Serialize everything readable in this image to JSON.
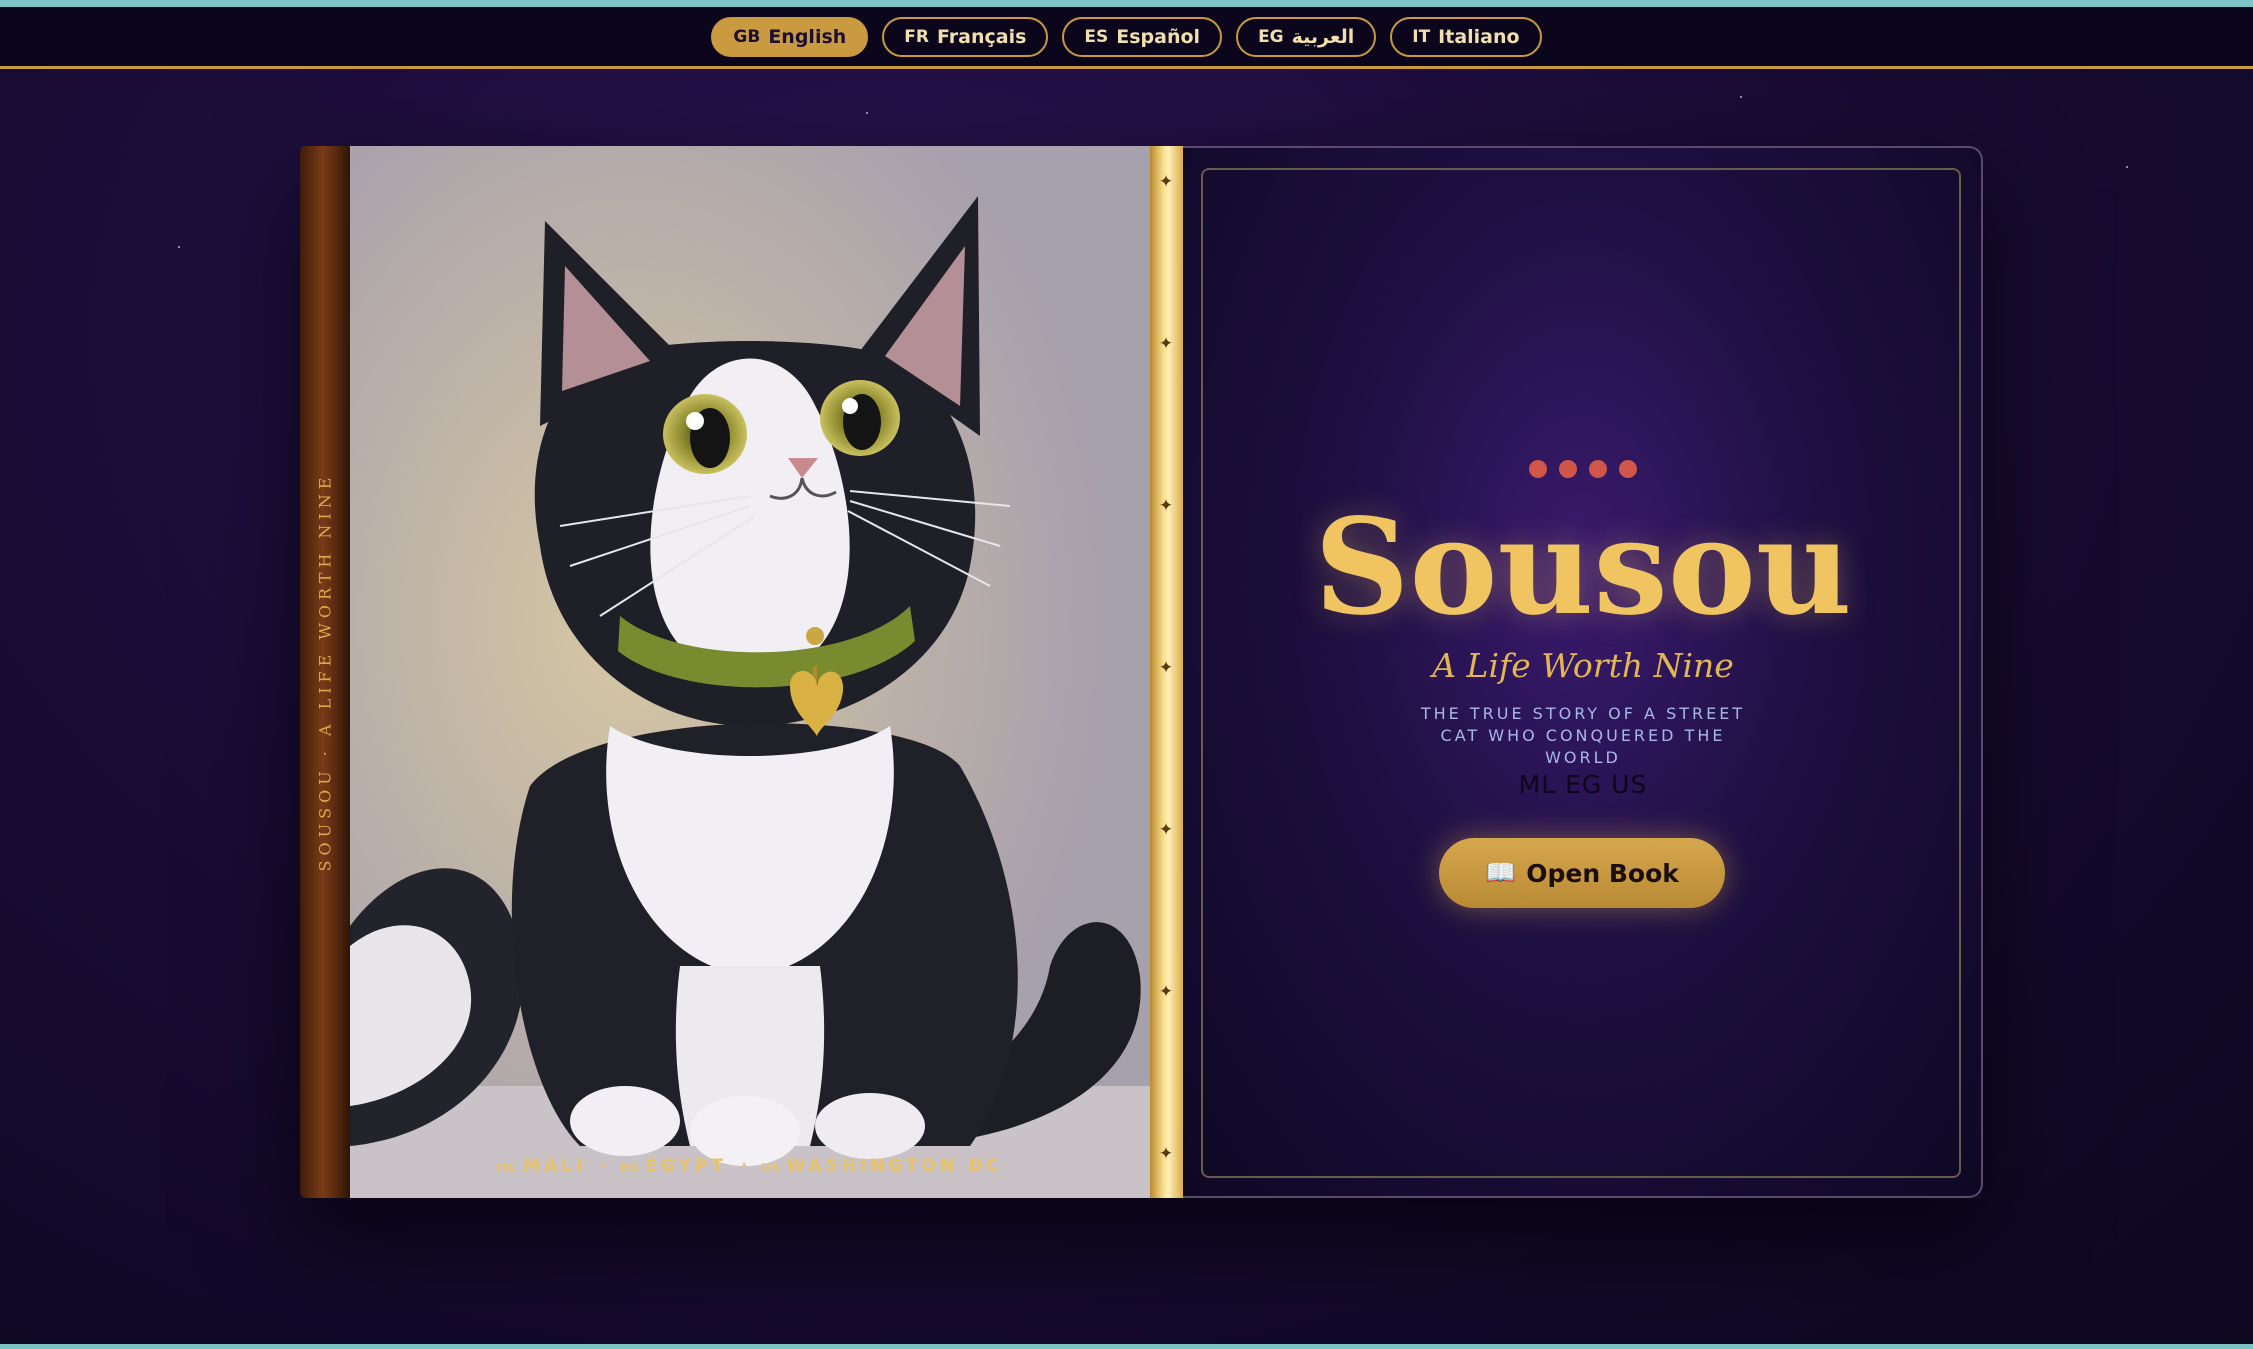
{
  "languages": [
    {
      "code": "GB",
      "label": "English",
      "active": true
    },
    {
      "code": "FR",
      "label": "Français",
      "active": false
    },
    {
      "code": "ES",
      "label": "Español",
      "active": false
    },
    {
      "code": "EG",
      "label": "العربية",
      "active": false
    },
    {
      "code": "IT",
      "label": "Italiano",
      "active": false
    }
  ],
  "spine": {
    "text": "SOUSOU · A LIFE WORTH NINE"
  },
  "cover": {
    "image": "tuxedo-cat-illustration",
    "caption": [
      {
        "code": "ML",
        "place": "MALI"
      },
      {
        "code": "EG",
        "place": "EGYPT"
      },
      {
        "code": "US",
        "place": "WASHINGTON DC"
      }
    ],
    "separator": "·"
  },
  "hinge": {
    "marker": "✦"
  },
  "title_page": {
    "title": "Sousou",
    "subtitle": "A Life Worth Nine",
    "tagline": "THE TRUE STORY OF A STREET CAT WHO CONQUERED THE WORLD",
    "countries": "ML EG US",
    "open_button_icon": "📖",
    "open_button_label": "Open Book"
  },
  "colors": {
    "gold": "#c99a3f",
    "title_gold": "#f0c460",
    "dot_red": "#d0564a",
    "background": "#1a0c36"
  }
}
